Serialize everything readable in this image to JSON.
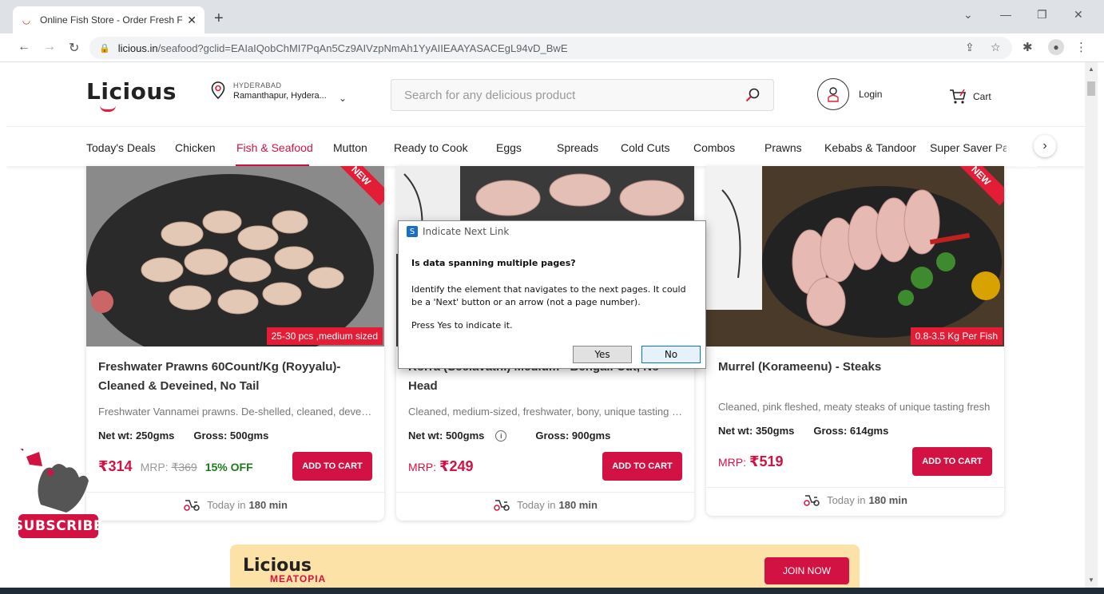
{
  "browser": {
    "tab_title": "Online Fish Store - Order Fresh F",
    "url_host": "licious.in",
    "url_path": "/seafood?gclid=EAIaIQobChMI7PqAn5Cz9AIVzpNmAh1YyAIIEAAYASACEgL94vD_BwE"
  },
  "header": {
    "logo": "Licious",
    "location_city": "HYDERABAD",
    "location_area": "Ramanthapur, Hydera...",
    "search_placeholder": "Search for any delicious product",
    "login_label": "Login",
    "cart_label": "Cart"
  },
  "categories": [
    {
      "label": "Today's Deals"
    },
    {
      "label": "Chicken"
    },
    {
      "label": "Fish & Seafood",
      "active": true
    },
    {
      "label": "Mutton"
    },
    {
      "label": "Ready to Cook"
    },
    {
      "label": "Eggs"
    },
    {
      "label": "Spreads"
    },
    {
      "label": "Cold Cuts"
    },
    {
      "label": "Combos"
    },
    {
      "label": "Prawns"
    },
    {
      "label": "Kebabs & Tandoor"
    },
    {
      "label": "Super Saver Pac"
    }
  ],
  "products": [
    {
      "name": "Freshwater Prawns 60Count/Kg (Royyalu)- Cleaned & Deveined, No Tail",
      "badge": "25-30 pcs ,medium sized",
      "tag": "NEW",
      "desc": "Freshwater Vannamei prawns. De-shelled, cleaned, deveined",
      "net_wt": "Net wt: 250gms",
      "gross": "Gross: 500gms",
      "price": "₹314",
      "mrp_label": "MRP:",
      "mrp": "₹369",
      "off": "15% OFF",
      "add_to_cart": "ADD TO CART",
      "delivery": "Today in",
      "delivery_time": "180 min"
    },
    {
      "name": "Korra (Seelavathi) Medium - Bengali Cut, No Head",
      "desc": "Cleaned, medium-sized, freshwater, bony, unique tasting fish",
      "net_wt": "Net wt: 500gms",
      "gross": "Gross: 900gms",
      "mrp_label": "MRP:",
      "price": "₹249",
      "add_to_cart": "ADD TO CART",
      "delivery": "Today in",
      "delivery_time": "180 min"
    },
    {
      "name": "Murrel (Korameenu) - Steaks",
      "badge": "0.8-3.5 Kg Per Fish",
      "tag": "NEW",
      "desc": "Cleaned, pink fleshed, meaty steaks of unique tasting fresh",
      "net_wt": "Net wt: 350gms",
      "gross": "Gross: 614gms",
      "mrp_label": "MRP:",
      "price": "₹519",
      "add_to_cart": "ADD TO CART",
      "delivery": "Today in",
      "delivery_time": "180 min"
    }
  ],
  "subscribe_label": "SUBSCRIBE",
  "banner": {
    "logo": "Licious",
    "sub": "MEATOPIA",
    "join": "JOIN NOW"
  },
  "dialog": {
    "title": "Indicate Next Link",
    "question": "Is data spanning multiple pages?",
    "message": "Identify the element that navigates to the next pages. It could be a 'Next' button or an arrow (not a page number).",
    "press": "Press Yes to indicate it.",
    "yes": "Yes",
    "no": "No"
  }
}
